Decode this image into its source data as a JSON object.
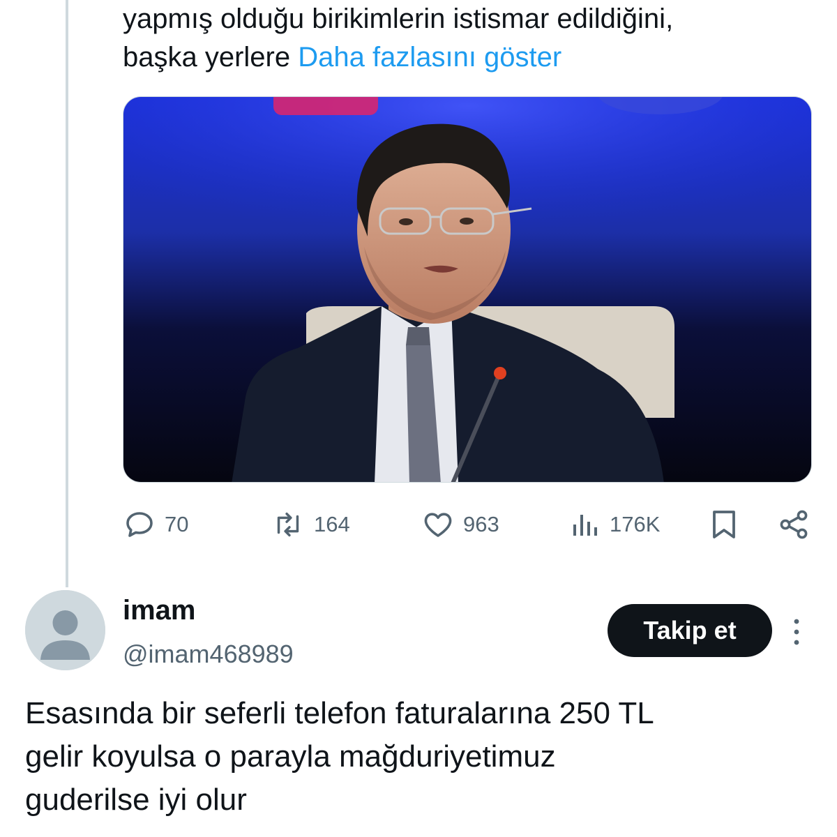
{
  "tweet": {
    "text_lines": [
      "yapmış olduğu birikimlerin istismar edildiğini,",
      "başka yerlere "
    ],
    "show_more": "Daha fazlasını göster",
    "stats": {
      "replies": "70",
      "reposts": "164",
      "likes": "963",
      "views": "176K"
    }
  },
  "reply": {
    "display_name": "imam",
    "handle": "@imam468989",
    "follow_label": "Takip et",
    "text_lines": [
      "Esasında bir seferli telefon faturalarına 250 TL",
      "gelir koyulsa o parayla mağduriyetimuz",
      "guderilse iyi olur"
    ]
  },
  "icons": {
    "reply": "comment-bubble-icon",
    "repost": "repost-arrows-icon",
    "like": "heart-icon",
    "views": "bar-chart-icon",
    "bookmark": "bookmark-icon",
    "share": "share-icon",
    "more": "vertical-dots-icon"
  },
  "colors": {
    "link": "#1d9bf0",
    "text": "#0f1419",
    "secondary": "#536471",
    "thread_line": "#cfd9de",
    "follow_button": "#0f1419",
    "avatar_bg": "#cfd9de"
  }
}
